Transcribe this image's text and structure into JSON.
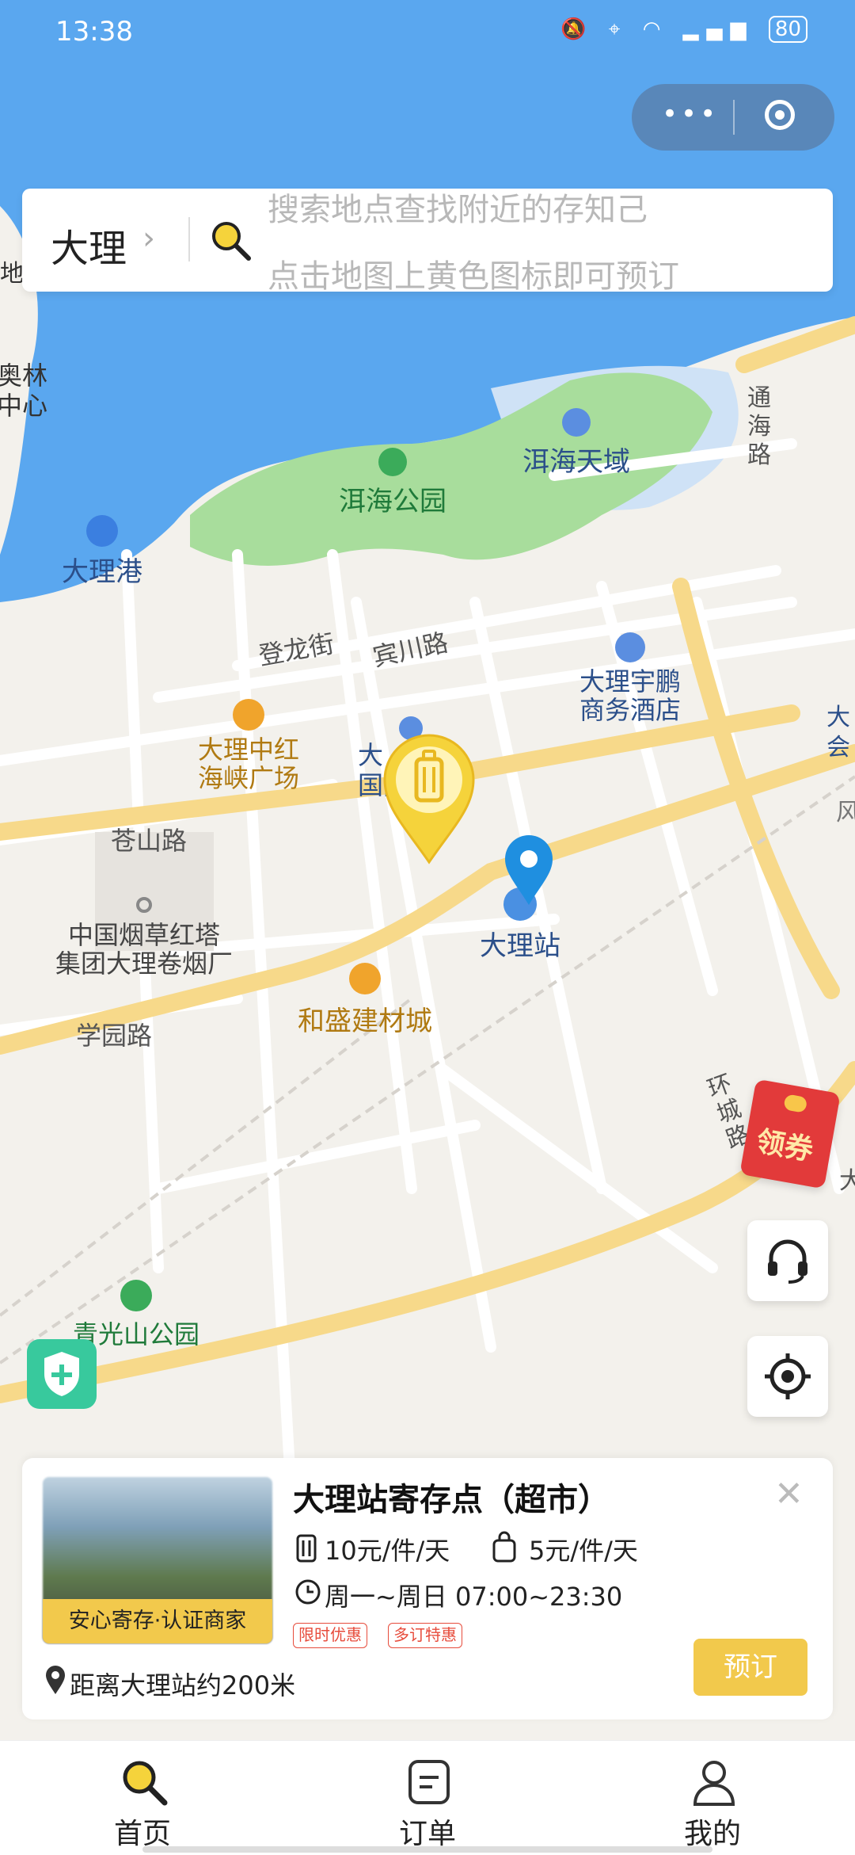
{
  "status_bar": {
    "time": "13:38",
    "battery": "80"
  },
  "search": {
    "city": "大理",
    "hint_line1": "搜索地点查找附近的存知己",
    "hint_line2": "点击地图上黄色图标即可预订"
  },
  "map_labels": {
    "lake_park": "洱海公园",
    "erhai_tianyu": "洱海天域",
    "dali_port": "大理港",
    "denglong_st": "登龙街",
    "binchuan_rd": "宾川路",
    "yupeng_hotel_1": "大理宇鹏",
    "yupeng_hotel_2": "商务酒店",
    "zhonghong_1": "大理中红",
    "zhonghong_2": "海峡广场",
    "guoji_1": "大",
    "guoji_2": "国际",
    "cangshan_rd": "苍山路",
    "dali_station": "大理站",
    "tobacco_1": "中国烟草红塔",
    "tobacco_2": "集团大理卷烟厂",
    "xueyuan_rd": "学园路",
    "hesheng": "和盛建材城",
    "huancheng_rd": "环城路",
    "tonghai_rd": "通海路",
    "qingguang_park": "青光山公园",
    "olympic_1": "奥林",
    "olympic_2": "中心",
    "edge_1": "地",
    "edge_2": "大",
    "edge_3": "会",
    "edge_4": "风",
    "edge_5": "大"
  },
  "coupon": {
    "label": "领券"
  },
  "store": {
    "title": "大理站寄存点（超市）",
    "price_luggage": "10元/件/天",
    "price_bag": "5元/件/天",
    "hours": "周一~周日 07:00~23:30",
    "tag1": "限时优惠",
    "tag2": "多订特惠",
    "caption": "安心寄存·认证商家",
    "distance": "距离大理站约200米",
    "book": "预订"
  },
  "tabs": [
    {
      "label": "首页"
    },
    {
      "label": "订单"
    },
    {
      "label": "我的"
    }
  ],
  "colors": {
    "accent": "#f2c94c",
    "water": "#5aa7ef",
    "park": "#a8dd9c"
  }
}
